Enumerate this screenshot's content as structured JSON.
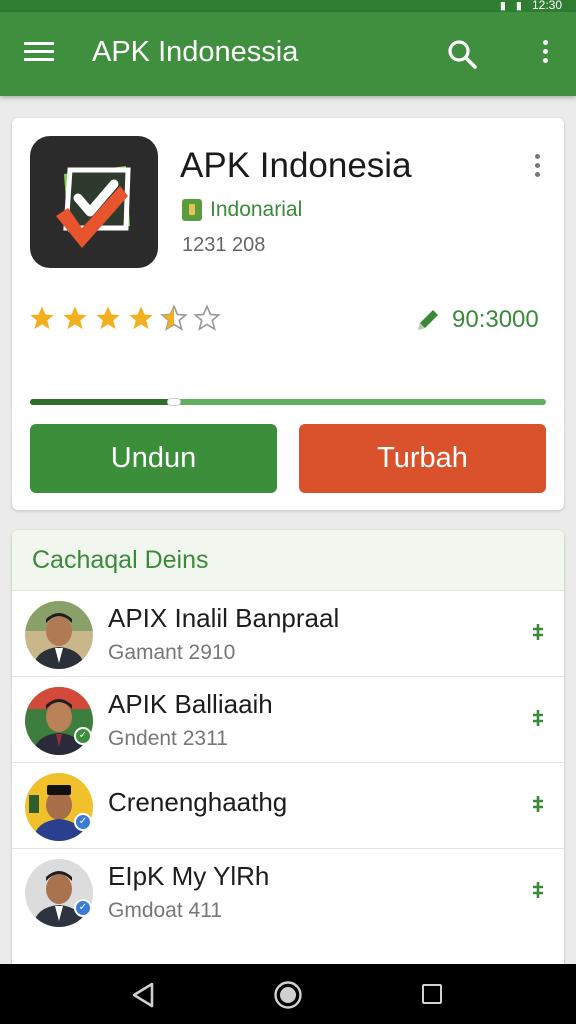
{
  "status_bar": {
    "time": "12:30"
  },
  "app_bar": {
    "title": "APK Indonessia"
  },
  "app_card": {
    "title": "APK Indonesia",
    "publisher": "Indonarial",
    "downloads": "1231 208",
    "rating": 4.5,
    "rating_max": 5,
    "edit_value": "90:3000",
    "progress": 0.28,
    "download_label": "Undun",
    "add_label": "Turbah"
  },
  "section": {
    "title": "Cachaqal Deins",
    "items": [
      {
        "title": "APIX Inalil Banpraal",
        "subtitle": "Gamant 2910"
      },
      {
        "title": "APIK Balliaaih",
        "subtitle": "Gndent 2311"
      },
      {
        "title": "Crenenghaathg",
        "subtitle": ""
      },
      {
        "title": "EIpK My YlRh",
        "subtitle": "Gmdoat 411"
      }
    ]
  },
  "colors": {
    "primary": "#3f8f3f",
    "primary_dark": "#2e7d32",
    "accent_red": "#d9522c",
    "star": "#f2b01e"
  }
}
